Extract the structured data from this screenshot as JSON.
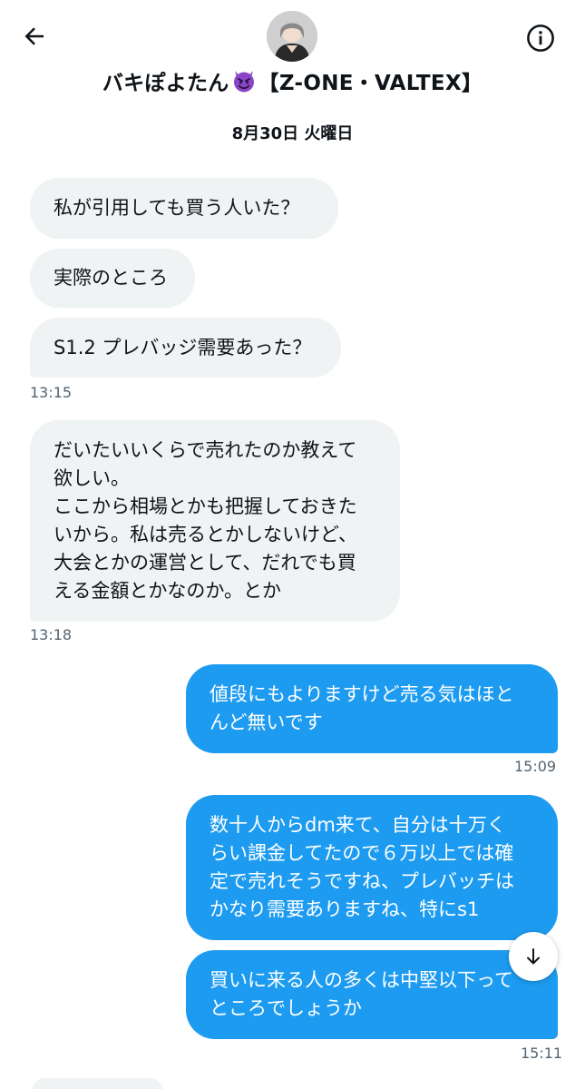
{
  "header": {
    "title_prefix": "バキぽよたん",
    "title_suffix": "【Z-ONE・VALTEX】",
    "back_icon": "arrow-left-icon",
    "info_icon": "info-icon",
    "avatar_icon": "user-avatar"
  },
  "date_separator": "8月30日 火曜日",
  "messages": [
    {
      "text": "私が引用しても買う人いた？"
    },
    {
      "text": "実際のところ"
    },
    {
      "text": "S1.2 プレバッジ需要あった？"
    },
    {
      "text": "だいたいいくらで売れたのか教えて\n欲しい。\nここから相場とかも把握しておきた\nいから。私は売るとかしないけど、\n大会とかの運営として、だれでも買\nえる金額とかなのか。とか"
    },
    {
      "text": "値段にもよりますけど売る気はほと\nんど無いです"
    },
    {
      "text": "数十人からdm来て、自分は十万く\nらい課金してたので６万以上では確\n定で売れそうですね、プレバッチは\nかなり需要ありますね、特にs1"
    },
    {
      "text": "買いに来る人の多くは中堅以下って\nところでしょうか"
    }
  ],
  "timestamps": [
    "13:15",
    "13:18",
    "15:09",
    "15:11"
  ],
  "scroll_icon": "arrow-down-icon",
  "colors": {
    "outgoing": "#1d9bf0",
    "incoming": "#eff3f4",
    "meta": "#536471"
  }
}
